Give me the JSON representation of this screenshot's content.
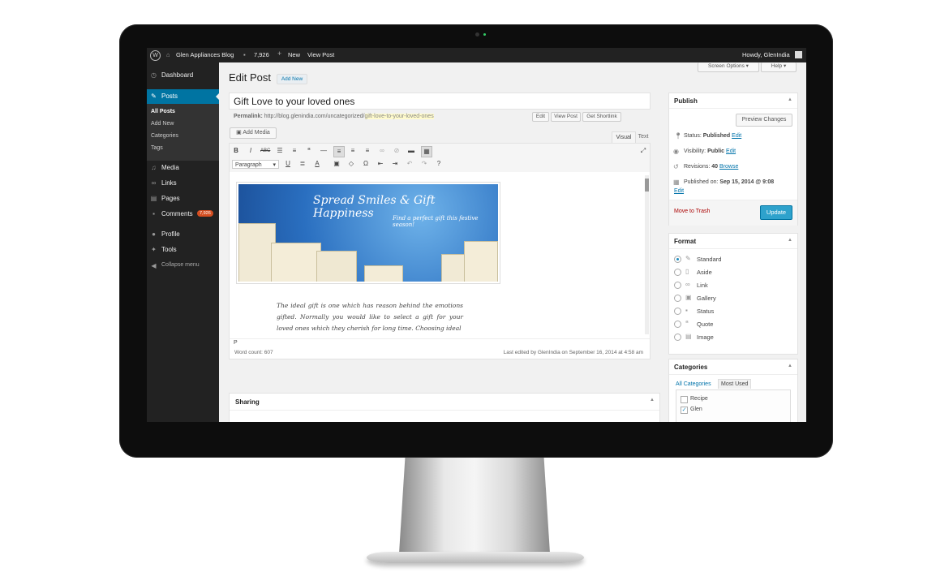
{
  "topbar": {
    "site_name": "Glen Appliances Blog",
    "comments_count": "7,926",
    "new_label": "New",
    "view_post_label": "View Post",
    "howdy": "Howdy, GlenIndia"
  },
  "sidebar": {
    "items": [
      {
        "label": "Dashboard",
        "icon": "dashboard-icon"
      },
      {
        "label": "Posts",
        "icon": "pin-icon"
      },
      {
        "label": "Media",
        "icon": "media-icon"
      },
      {
        "label": "Links",
        "icon": "link-icon"
      },
      {
        "label": "Pages",
        "icon": "pages-icon"
      },
      {
        "label": "Comments",
        "icon": "comment-icon",
        "badge": "7,926"
      },
      {
        "label": "Profile",
        "icon": "user-icon"
      },
      {
        "label": "Tools",
        "icon": "wrench-icon"
      },
      {
        "label": "Collapse menu",
        "icon": "collapse-icon"
      }
    ],
    "posts_sub": [
      "All Posts",
      "Add New",
      "Categories",
      "Tags"
    ]
  },
  "header": {
    "title": "Edit Post",
    "add_new": "Add New",
    "screen_options": "Screen Options",
    "help": "Help"
  },
  "post": {
    "title": "Gift Love to your loved ones",
    "permalink_label": "Permalink:",
    "permalink_base": "http://blog.glenindia.com/uncategorized/",
    "permalink_slug": "gift-love-to-your-loved-ones",
    "edit_btn": "Edit",
    "view_post_btn": "View Post",
    "shortlink_btn": "Get Shortlink",
    "add_media": "Add Media",
    "tab_visual": "Visual",
    "tab_text": "Text",
    "format_select": "Paragraph",
    "banner_title": "Spread Smiles & Gift Happiness",
    "banner_subtitle": "Find a perfect gift this festive season!",
    "body_text": "The ideal gift is one which has reason behind the emotions gifted. Normally you would like to select a gift for your loved ones which they cherish for long time. Choosing ideal",
    "path": "P",
    "word_count": "Word count: 607",
    "last_edited": "Last edited by GlenIndia on September 16, 2014 at 4:58 am"
  },
  "sharing": {
    "title": "Sharing"
  },
  "publish": {
    "title": "Publish",
    "preview": "Preview Changes",
    "status_label": "Status:",
    "status_value": "Published",
    "visibility_label": "Visibility:",
    "visibility_value": "Public",
    "revisions_label": "Revisions:",
    "revisions_value": "40",
    "browse": "Browse",
    "published_on_label": "Published on:",
    "published_on_value": "Sep 15, 2014 @ 9:08",
    "edit": "Edit",
    "trash": "Move to Trash",
    "update": "Update"
  },
  "format": {
    "title": "Format",
    "options": [
      "Standard",
      "Aside",
      "Link",
      "Gallery",
      "Status",
      "Quote",
      "Image"
    ],
    "selected": "Standard"
  },
  "categories": {
    "title": "Categories",
    "tab_all": "All Categories",
    "tab_used": "Most Used",
    "items": [
      {
        "label": "Recipe",
        "checked": false
      },
      {
        "label": "Glen",
        "checked": true
      }
    ]
  },
  "colors": {
    "accent": "#0073aa",
    "active_menu": "#0074a2",
    "badge": "#d54e21",
    "update_btn": "#2ea2cc"
  }
}
